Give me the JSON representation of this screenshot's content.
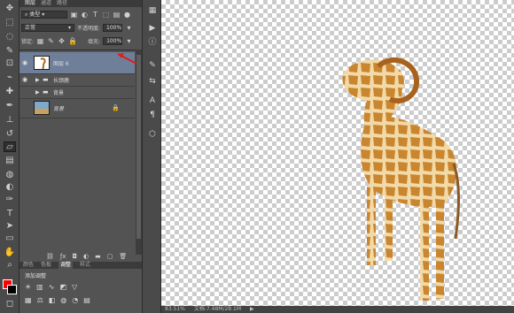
{
  "layers_panel": {
    "tabs": [
      "图层",
      "通道",
      "路径"
    ],
    "filter_type": "类型",
    "blend_mode": "正常",
    "opacity_label": "不透明度:",
    "opacity_value": "100%",
    "lock_label": "锁定:",
    "fill_label": "填充:",
    "fill_value": "100%",
    "layers": [
      {
        "name": "图层 6",
        "selected": true
      },
      {
        "name": "长颈鹿",
        "type": "group"
      },
      {
        "name": "背景",
        "type": "group"
      },
      {
        "name": "背景",
        "type": "locked"
      }
    ]
  },
  "bottom_panel": {
    "tabs": [
      "颜色",
      "色板",
      "调整",
      "样式"
    ],
    "active_tab": "调整",
    "adjust_title": "添加调整"
  },
  "status": {
    "zoom": "83.51%",
    "doc_size": "文档:7.48M/28.1M"
  },
  "colors": {
    "foreground": "#ff0000",
    "background": "#000000",
    "selected_layer": "#6f7f99",
    "annotation_arrow": "#d9201c"
  },
  "icons": [
    "eye-icon",
    "folder-icon",
    "lock-icon",
    "link-icon",
    "fx-icon",
    "mask-icon",
    "new-layer-icon",
    "trash-icon"
  ]
}
